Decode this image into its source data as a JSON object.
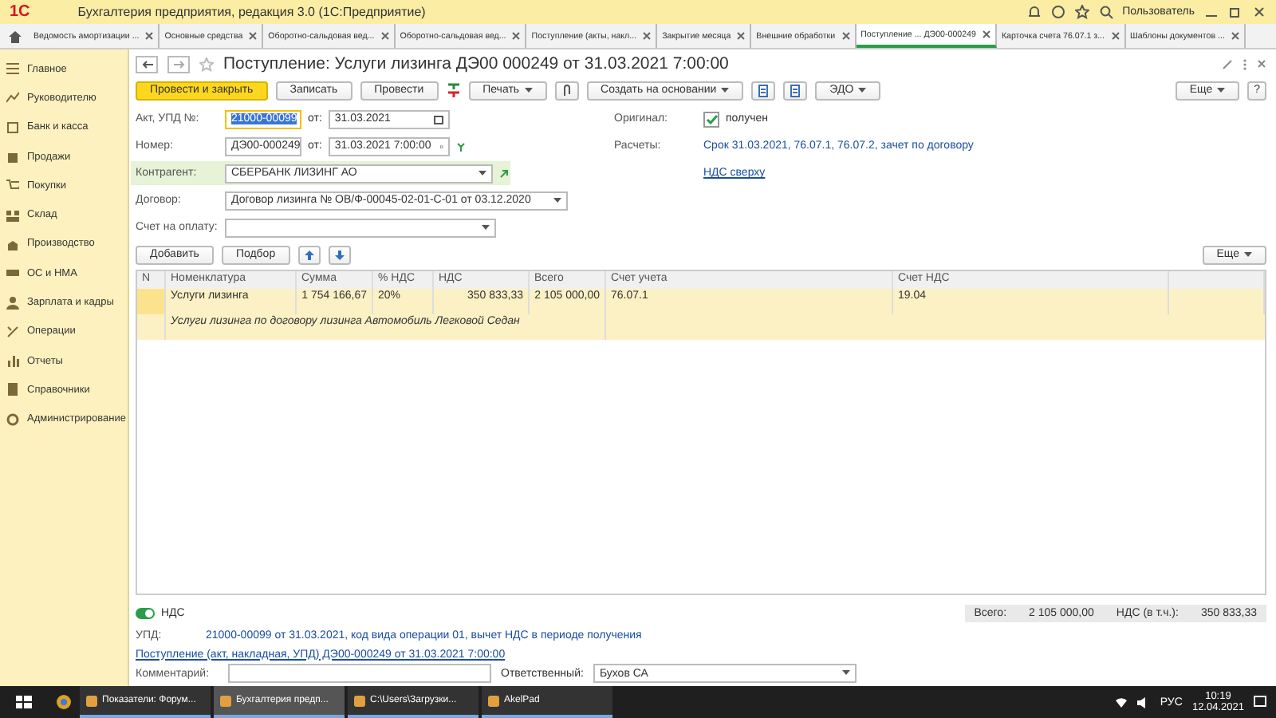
{
  "app_bar": {
    "logo": "1С",
    "title": "Бухгалтерия предприятия, редакция 3.0 (1С:Предприятие)",
    "user": "Пользователь"
  },
  "open_tabs": [
    {
      "label": "Ведомость амортизации ...",
      "selected": false
    },
    {
      "label": "Основные средства",
      "selected": false
    },
    {
      "label": "Оборотно-сальдовая вед...",
      "selected": false
    },
    {
      "label": "Оборотно-сальдовая вед...",
      "selected": false
    },
    {
      "label": "Поступление (акты, накл...",
      "selected": false
    },
    {
      "label": "Закрытие месяца",
      "selected": false
    },
    {
      "label": "Внешние обработки",
      "selected": false
    },
    {
      "label": "Поступление ... ДЭ00-000249",
      "selected": true
    },
    {
      "label": "Карточка счета 76.07.1 з...",
      "selected": false
    },
    {
      "label": "Шаблоны документов ...",
      "selected": false
    }
  ],
  "sidebar": {
    "items": [
      {
        "label": "Главное"
      },
      {
        "label": "Руководителю"
      },
      {
        "label": "Банк и касса"
      },
      {
        "label": "Продажи"
      },
      {
        "label": "Покупки"
      },
      {
        "label": "Склад"
      },
      {
        "label": "Производство"
      },
      {
        "label": "ОС и НМА"
      },
      {
        "label": "Зарплата и кадры"
      },
      {
        "label": "Операции"
      },
      {
        "label": "Отчеты"
      },
      {
        "label": "Справочники"
      },
      {
        "label": "Администрирование"
      }
    ]
  },
  "document": {
    "title": "Поступление: Услуги лизинга ДЭ00 000249 от 31.03.2021 7:00:00",
    "toolbar": [
      {
        "kind": "primary",
        "label": "Провести и закрыть"
      },
      {
        "kind": "button",
        "label": "Записать"
      },
      {
        "kind": "button",
        "label": "Провести"
      },
      {
        "kind": "dtkt"
      },
      {
        "kind": "menu",
        "label": "Печать"
      },
      {
        "kind": "clip"
      },
      {
        "kind": "menu",
        "label": "Создать на основании"
      },
      {
        "kind": "doc"
      },
      {
        "kind": "doc"
      },
      {
        "kind": "menu",
        "label": "ЭДО"
      }
    ],
    "more_button": "Еще",
    "help_button": "?",
    "act_number": {
      "label": "Акт, УПД №:",
      "value": "21000-00099",
      "date_label": "от:",
      "date": "31.03.2021"
    },
    "number": {
      "label": "Номер:",
      "value": "ДЭ00-000249",
      "date_label": "от:",
      "date": "31.03.2021  7:00:00"
    },
    "original": {
      "label": "Оригинал:",
      "checked": true,
      "text": "получен"
    },
    "payments": {
      "label": "Расчеты:",
      "link": "Срок 31.03.2021, 76.07.1, 76.07.2, зачет по договору"
    },
    "counterparty": {
      "label": "Контрагент:",
      "value": "СБЕРБАНК ЛИЗИНГ АО"
    },
    "vat_link": "НДС сверху",
    "contract": {
      "label": "Договор:",
      "value": "Договор лизинга № ОВ/Ф-00045-02-01-С-01 от 03.12.2020"
    },
    "invoice": {
      "label": "Счет на оплату:"
    }
  },
  "table": {
    "add_button": "Добавить",
    "pick_button": "Подбор",
    "more_button": "Еще",
    "columns": [
      "N",
      "Номенклатура",
      "Сумма",
      "% НДС",
      "НДС",
      "Всего",
      "Счет учета",
      "Счет НДС"
    ],
    "rows": [
      {
        "selected": true,
        "cells": [
          "",
          "Услуги лизинга",
          "1 754 166,67",
          "20%",
          "350 833,33",
          "2 105 000,00",
          "76.07.1",
          "19.04"
        ],
        "description": "Услуги лизинга по договору лизинга Автомобиль Легковой Седан"
      }
    ]
  },
  "totals": {
    "toggle_on": true,
    "toggle_label": "НДС",
    "total_label": "Всего:",
    "total": "2 105 000,00",
    "vat_label": "НДС (в т.ч.):",
    "vat": "350 833,33"
  },
  "footer": {
    "upd_label": "УПД:",
    "upd_link": "21000-00099 от 31.03.2021, код вида операции 01, вычет НДС в периоде получения",
    "doc_link": "Поступление (акт, накладная, УПД) ДЭ00-000249 от 31.03.2021 7:00:00",
    "comment_label": "Комментарий:",
    "responsible_label": "Ответственный:",
    "responsible": "Бухов СА"
  },
  "taskbar": {
    "apps": [
      {
        "label": "Показатели: Форум...",
        "selected": false
      },
      {
        "label": "Бухгалтерия предп...",
        "selected": true
      },
      {
        "label": "C:\\Users\\Загрузки...",
        "selected": false
      },
      {
        "label": "AkelPad",
        "selected": false
      }
    ],
    "language": "РУС",
    "time": "10:19",
    "date": "12.04.2021"
  }
}
